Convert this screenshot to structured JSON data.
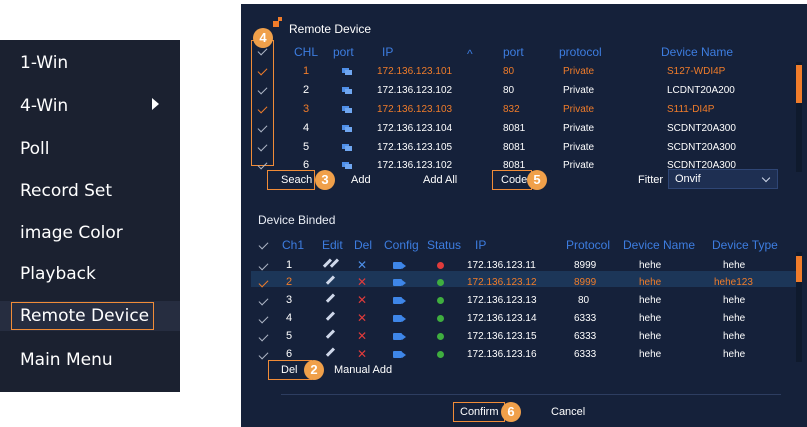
{
  "menu": {
    "items": [
      "1-Win",
      "4-Win",
      "Poll",
      "Record Set",
      "image Color",
      "Playback",
      "Remote Device",
      "Main Menu"
    ]
  },
  "remote": {
    "title": "Remote Device",
    "headers": {
      "chl": "CHL",
      "port": "port",
      "ip": "IP",
      "port2": "port",
      "protocol": "protocol",
      "name": "Device Name"
    },
    "sort_arrow": "^",
    "rows": [
      {
        "chl": "1",
        "ip": "172.136.123.101",
        "port": "80",
        "protocol": "Private",
        "name": "S127-WDI4P",
        "highlight": true
      },
      {
        "chl": "2",
        "ip": "172.136.123.102",
        "port": "80",
        "protocol": "Private",
        "name": "LCDNT20A200",
        "highlight": false
      },
      {
        "chl": "3",
        "ip": "172.136.123.103",
        "port": "832",
        "protocol": "Private",
        "name": "S111-DI4P",
        "highlight": true
      },
      {
        "chl": "4",
        "ip": "172.136.123.104",
        "port": "8081",
        "protocol": "Private",
        "name": "SCDNT20A300",
        "highlight": false
      },
      {
        "chl": "5",
        "ip": "172.136.123.105",
        "port": "8081",
        "protocol": "Private",
        "name": "SCDNT20A300",
        "highlight": false
      },
      {
        "chl": "6",
        "ip": "172.136.123.102",
        "port": "8081",
        "protocol": "Private",
        "name": "SCDNT20A300",
        "highlight": false
      }
    ],
    "buttons": {
      "search": "Seach",
      "add": "Add",
      "add_all": "Add All",
      "code": "Code"
    },
    "filter_label": "Fitter",
    "filter_value": "Onvif"
  },
  "binded": {
    "title": "Device Binded",
    "headers": {
      "ch": "Ch1",
      "edit": "Edit",
      "del": "Del",
      "config": "Config",
      "status": "Status",
      "ip": "IP",
      "protocol": "Protocol",
      "name": "Device Name",
      "type": "Device Type"
    },
    "rows": [
      {
        "ch": "1",
        "ip": "172.136.123.11",
        "port": "8999",
        "name": "hehe",
        "type": "hehe",
        "status": "offline"
      },
      {
        "ch": "2",
        "ip": "172.136.123.12",
        "port": "8999",
        "name": "hehe",
        "type": "hehe123",
        "status": "online"
      },
      {
        "ch": "3",
        "ip": "172.136.123.13",
        "port": "80",
        "name": "hehe",
        "type": "hehe",
        "status": "online"
      },
      {
        "ch": "4",
        "ip": "172.136.123.14",
        "port": "6333",
        "name": "hehe",
        "type": "hehe",
        "status": "online"
      },
      {
        "ch": "5",
        "ip": "172.136.123.15",
        "port": "6333",
        "name": "hehe",
        "type": "hehe",
        "status": "online"
      },
      {
        "ch": "6",
        "ip": "172.136.123.16",
        "port": "6333",
        "name": "hehe",
        "type": "hehe",
        "status": "online"
      }
    ],
    "buttons": {
      "del": "Del",
      "manual_add": "Manual Add"
    }
  },
  "footer": {
    "confirm": "Confirm",
    "cancel": "Cancel"
  },
  "badges": {
    "b4": "4",
    "b3": "3",
    "b5": "5",
    "b2": "2",
    "b6": "6"
  },
  "colors": {
    "accent": "#f07c2a",
    "header_blue": "#3d7de0",
    "panel_bg": "#15213a",
    "online": "#3fae3f",
    "offline": "#e03b3b"
  }
}
